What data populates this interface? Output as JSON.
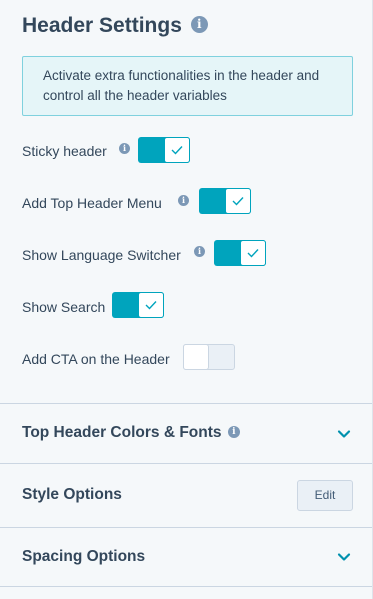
{
  "header_settings": {
    "title": "Header Settings",
    "notice": "Activate extra functionalities in the header and control all the header variables",
    "toggles": [
      {
        "label": "Sticky header",
        "has_info": true,
        "checked": true
      },
      {
        "label": "Add Top Header Menu",
        "has_info": true,
        "checked": true
      },
      {
        "label": "Show Language Switcher",
        "has_info": true,
        "checked": true
      },
      {
        "label": "Show Search",
        "has_info": false,
        "checked": true
      },
      {
        "label": "Add CTA on the Header",
        "has_info": false,
        "checked": false
      }
    ]
  },
  "sections": [
    {
      "label": "Top Header Colors & Fonts",
      "has_info": true,
      "control": "chevron-down-icon"
    },
    {
      "label": "Style Options",
      "has_info": false,
      "control": "button",
      "button_label": "Edit"
    },
    {
      "label": "Spacing Options",
      "has_info": false,
      "control": "chevron-down-icon"
    }
  ],
  "icons": {
    "info": "info-icon",
    "check": "check-icon",
    "chevron": "chevron-down-icon"
  },
  "colors": {
    "accent": "#00a4bd",
    "text": "#33475b",
    "info_icon": "#7c98b6",
    "notice_bg": "#e5f5f8",
    "notice_border": "#7fd1de",
    "panel_bg": "#f5f8fa",
    "divider": "#cbd6e2"
  }
}
